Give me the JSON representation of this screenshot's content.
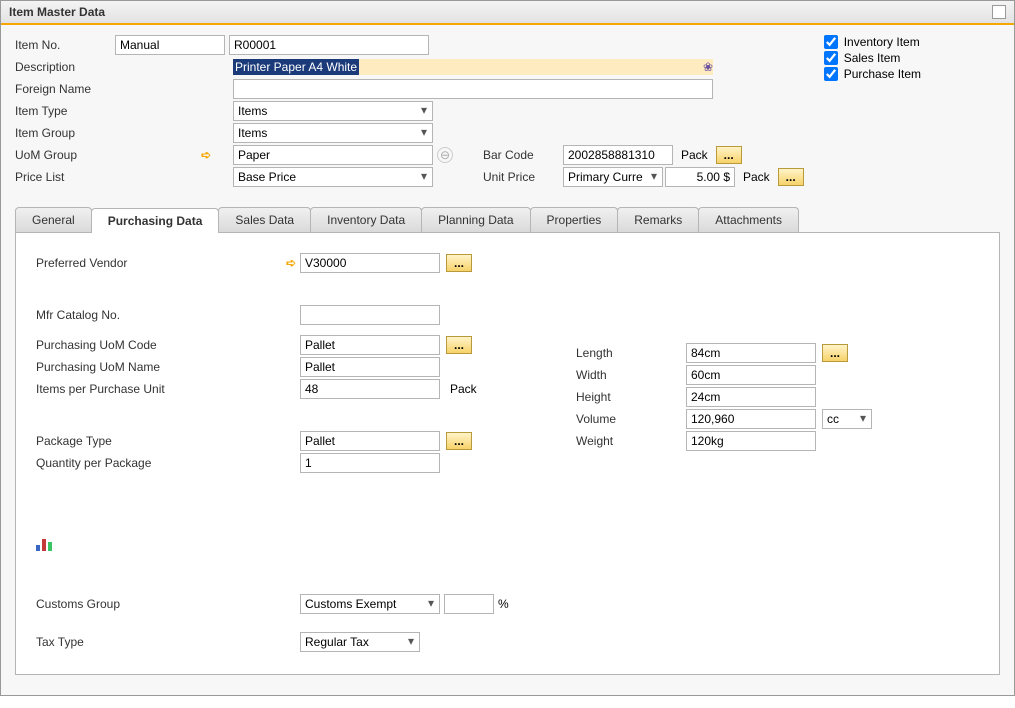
{
  "title": "Item Master Data",
  "header": {
    "itemNoLabel": "Item No.",
    "itemNoMode": "Manual",
    "itemNo": "R00001",
    "descriptionLabel": "Description",
    "description": "Printer Paper A4 White",
    "foreignNameLabel": "Foreign Name",
    "foreignName": "",
    "itemTypeLabel": "Item Type",
    "itemType": "Items",
    "itemGroupLabel": "Item Group",
    "itemGroup": "Items",
    "uomGroupLabel": "UoM Group",
    "uomGroup": "Paper",
    "priceListLabel": "Price List",
    "priceList": "Base Price",
    "barCodeLabel": "Bar Code",
    "barCode": "2002858881310",
    "barCodeUnit": "Pack",
    "unitPriceLabel": "Unit Price",
    "unitPriceCurrency": "Primary Curre",
    "unitPrice": "5.00 $",
    "unitPriceUnit": "Pack"
  },
  "flags": {
    "inventoryLabel": "Inventory Item",
    "salesLabel": "Sales Item",
    "purchaseLabel": "Purchase Item"
  },
  "tabs": [
    "General",
    "Purchasing Data",
    "Sales Data",
    "Inventory Data",
    "Planning Data",
    "Properties",
    "Remarks",
    "Attachments"
  ],
  "purchasing": {
    "preferredVendorLabel": "Preferred Vendor",
    "preferredVendor": "V30000",
    "mfrCatalogLabel": "Mfr Catalog No.",
    "mfrCatalog": "",
    "puomCodeLabel": "Purchasing UoM Code",
    "puomCode": "Pallet",
    "puomNameLabel": "Purchasing UoM Name",
    "puomName": "Pallet",
    "itemsPerUnitLabel": "Items per Purchase Unit",
    "itemsPerUnit": "48",
    "itemsPerUnitSuffix": "Pack",
    "packageTypeLabel": "Package Type",
    "packageType": "Pallet",
    "qtyPerPackageLabel": "Quantity per Package",
    "qtyPerPackage": "1",
    "lengthLabel": "Length",
    "length": "84cm",
    "widthLabel": "Width",
    "width": "60cm",
    "heightLabel": "Height",
    "height": "24cm",
    "volumeLabel": "Volume",
    "volume": "120,960",
    "volumeUnit": "cc",
    "weightLabel": "Weight",
    "weight": "120kg",
    "customsGroupLabel": "Customs Group",
    "customsGroup": "Customs Exempt",
    "customsPercent": "",
    "percentSign": "%",
    "taxTypeLabel": "Tax Type",
    "taxType": "Regular Tax"
  }
}
